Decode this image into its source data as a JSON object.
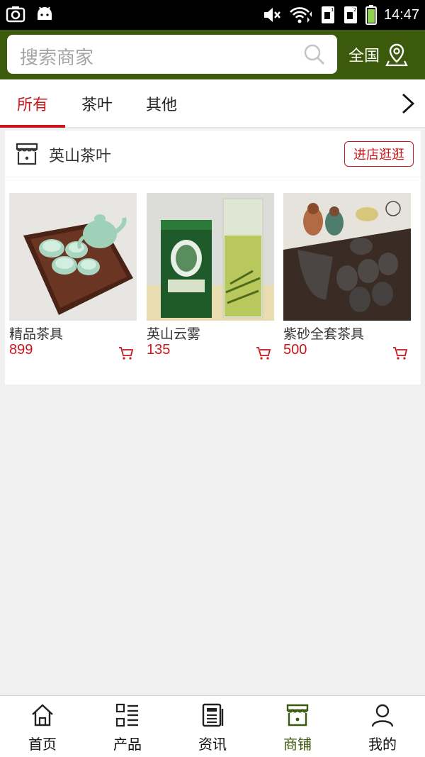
{
  "status_bar": {
    "time": "14:47",
    "icons": [
      "screenshot-icon",
      "android-icon",
      "mute-icon",
      "wifi-icon",
      "sim1-icon",
      "sim2-icon",
      "battery-icon"
    ]
  },
  "header": {
    "search_placeholder": "搜索商家",
    "region_label": "全国",
    "bg_color": "#3b5a0b"
  },
  "tabs": [
    {
      "label": "所有",
      "active": true
    },
    {
      "label": "茶叶",
      "active": false
    },
    {
      "label": "其他",
      "active": false
    }
  ],
  "shop": {
    "name": "英山茶叶",
    "visit_label": "进店逛逛",
    "products": [
      {
        "name": "精品茶具",
        "price": "899",
        "image": "celadon-tea-set"
      },
      {
        "name": "英山云雾",
        "price": "135",
        "image": "green-tea-tin-and-glass"
      },
      {
        "name": "紫砂全套茶具",
        "price": "500",
        "image": "zisha-tea-set"
      }
    ]
  },
  "bottom_nav": [
    {
      "label": "首页",
      "icon": "home-icon",
      "active": false
    },
    {
      "label": "产品",
      "icon": "product-list-icon",
      "active": false
    },
    {
      "label": "资讯",
      "icon": "news-icon",
      "active": false
    },
    {
      "label": "商铺",
      "icon": "store-icon",
      "active": true
    },
    {
      "label": "我的",
      "icon": "user-icon",
      "active": false
    }
  ],
  "colors": {
    "accent_red": "#c9161d",
    "brand_green": "#3b5a0b"
  }
}
